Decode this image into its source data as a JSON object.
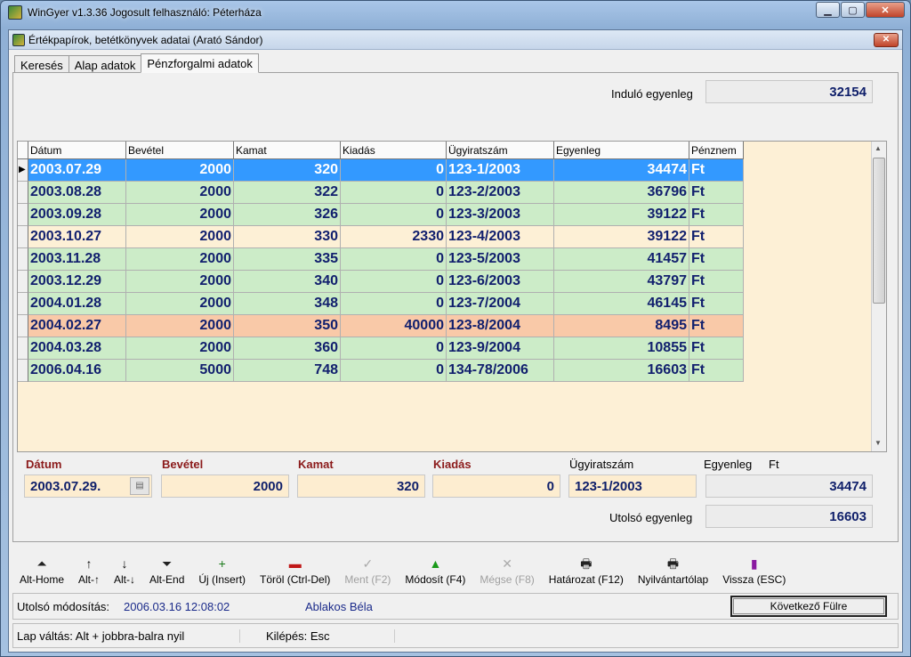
{
  "window": {
    "title": "WinGyer v1.3.36 Jogosult felhasználó: Péterháza",
    "min": "▁",
    "max": "▢",
    "close": "✕"
  },
  "inner": {
    "title": "Értékpapírok, betétkönyvek adatai (Arató Sándor)",
    "close": "✕"
  },
  "tabs": [
    "Keresés",
    "Alap adatok",
    "Pénzforgalmi adatok"
  ],
  "opening": {
    "label": "Induló egyenleg",
    "value": "32154"
  },
  "grid": {
    "columns": [
      "Dátum",
      "Bevétel",
      "Kamat",
      "Kiadás",
      "Ügyiratszám",
      "Egyenleg",
      "Pénznem"
    ],
    "rows": [
      [
        "2003.07.29",
        "2000",
        "320",
        "0",
        "123-1/2003",
        "34474",
        "Ft"
      ],
      [
        "2003.08.28",
        "2000",
        "322",
        "0",
        "123-2/2003",
        "36796",
        "Ft"
      ],
      [
        "2003.09.28",
        "2000",
        "326",
        "0",
        "123-3/2003",
        "39122",
        "Ft"
      ],
      [
        "2003.10.27",
        "2000",
        "330",
        "2330",
        "123-4/2003",
        "39122",
        "Ft"
      ],
      [
        "2003.11.28",
        "2000",
        "335",
        "0",
        "123-5/2003",
        "41457",
        "Ft"
      ],
      [
        "2003.12.29",
        "2000",
        "340",
        "0",
        "123-6/2003",
        "43797",
        "Ft"
      ],
      [
        "2004.01.28",
        "2000",
        "348",
        "0",
        "123-7/2004",
        "46145",
        "Ft"
      ],
      [
        "2004.02.27",
        "2000",
        "350",
        "40000",
        "123-8/2004",
        "8495",
        "Ft"
      ],
      [
        "2004.03.28",
        "2000",
        "360",
        "0",
        "123-9/2004",
        "10855",
        "Ft"
      ],
      [
        "2006.04.16",
        "5000",
        "748",
        "0",
        "134-78/2006",
        "16603",
        "Ft"
      ]
    ],
    "row_colors": [
      "#3399ff",
      "#ccecc8",
      "#ccecc8",
      "#fdf0d6",
      "#ccecc8",
      "#ccecc8",
      "#ccecc8",
      "#f9c9a8",
      "#ccecc8",
      "#ccecc8"
    ],
    "selected_text_color": "#ffffff"
  },
  "form": {
    "date_label": "Dátum",
    "date_value": "2003.07.29.",
    "income_label": "Bevétel",
    "income_value": "2000",
    "interest_label": "Kamat",
    "interest_value": "320",
    "expense_label": "Kiadás",
    "expense_value": "0",
    "file_label": "Ügyiratszám",
    "file_value": "123-1/2003",
    "balance_label": "Egyenleg",
    "currency": "Ft",
    "balance_value": "34474",
    "last_balance_label": "Utolsó egyenleg",
    "last_balance_value": "16603"
  },
  "toolbar": [
    {
      "label": "Alt-Home",
      "icon": "first-record-icon",
      "glyph": "⏶",
      "enabled": true
    },
    {
      "label": "Alt-↑",
      "icon": "arrow-up-icon",
      "glyph": "↑",
      "enabled": true
    },
    {
      "label": "Alt-↓",
      "icon": "arrow-down-icon",
      "glyph": "↓",
      "enabled": true
    },
    {
      "label": "Alt-End",
      "icon": "last-record-icon",
      "glyph": "⏷",
      "enabled": true
    },
    {
      "label": "Új (Insert)",
      "icon": "plus-icon",
      "glyph": "+",
      "enabled": true
    },
    {
      "label": "Töröl (Ctrl-Del)",
      "icon": "minus-icon",
      "glyph": "▬",
      "enabled": true
    },
    {
      "label": "Ment (F2)",
      "icon": "check-icon",
      "glyph": "✓",
      "enabled": false
    },
    {
      "label": "Módosít (F4)",
      "icon": "triangle-up-icon",
      "glyph": "▲",
      "enabled": true
    },
    {
      "label": "Mégse (F8)",
      "icon": "x-icon",
      "glyph": "✕",
      "enabled": false
    },
    {
      "label": "Határozat (F12)",
      "icon": "printer-icon",
      "glyph": "🖶",
      "enabled": true
    },
    {
      "label": "Nyilvántartólap",
      "icon": "printer-icon",
      "glyph": "🖶",
      "enabled": true
    },
    {
      "label": "Vissza (ESC)",
      "icon": "exit-door-icon",
      "glyph": "▮",
      "enabled": true
    }
  ],
  "status": {
    "modified_label": "Utolsó módosítás:",
    "modified_value": "2006.03.16 12:08:02",
    "user": "Ablakos Béla",
    "next_button": "Következő Fülre"
  },
  "status2": {
    "tab_switch": "Lap váltás: Alt + jobbra-balra nyil",
    "exit": "Kilépés: Esc"
  }
}
